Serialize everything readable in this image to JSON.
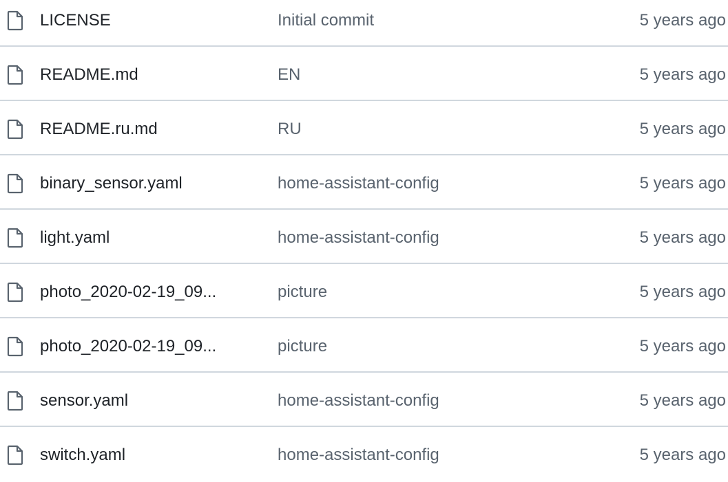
{
  "files": [
    {
      "icon": "file-icon",
      "name": "LICENSE",
      "commit": "Initial commit",
      "age": "5 years ago"
    },
    {
      "icon": "file-icon",
      "name": "README.md",
      "commit": "EN",
      "age": "5 years ago"
    },
    {
      "icon": "file-icon",
      "name": "README.ru.md",
      "commit": "RU",
      "age": "5 years ago"
    },
    {
      "icon": "file-icon",
      "name": "binary_sensor.yaml",
      "commit": "home-assistant-config",
      "age": "5 years ago"
    },
    {
      "icon": "file-icon",
      "name": "light.yaml",
      "commit": "home-assistant-config",
      "age": "5 years ago"
    },
    {
      "icon": "file-icon",
      "name": "photo_2020-02-19_09...",
      "commit": "picture",
      "age": "5 years ago"
    },
    {
      "icon": "file-icon",
      "name": "photo_2020-02-19_09...",
      "commit": "picture",
      "age": "5 years ago"
    },
    {
      "icon": "file-icon",
      "name": "sensor.yaml",
      "commit": "home-assistant-config",
      "age": "5 years ago"
    },
    {
      "icon": "file-icon",
      "name": "switch.yaml",
      "commit": "home-assistant-config",
      "age": "5 years ago"
    }
  ],
  "colors": {
    "text": "#1f2328",
    "muted": "#59636e",
    "border": "#d0d7de"
  }
}
